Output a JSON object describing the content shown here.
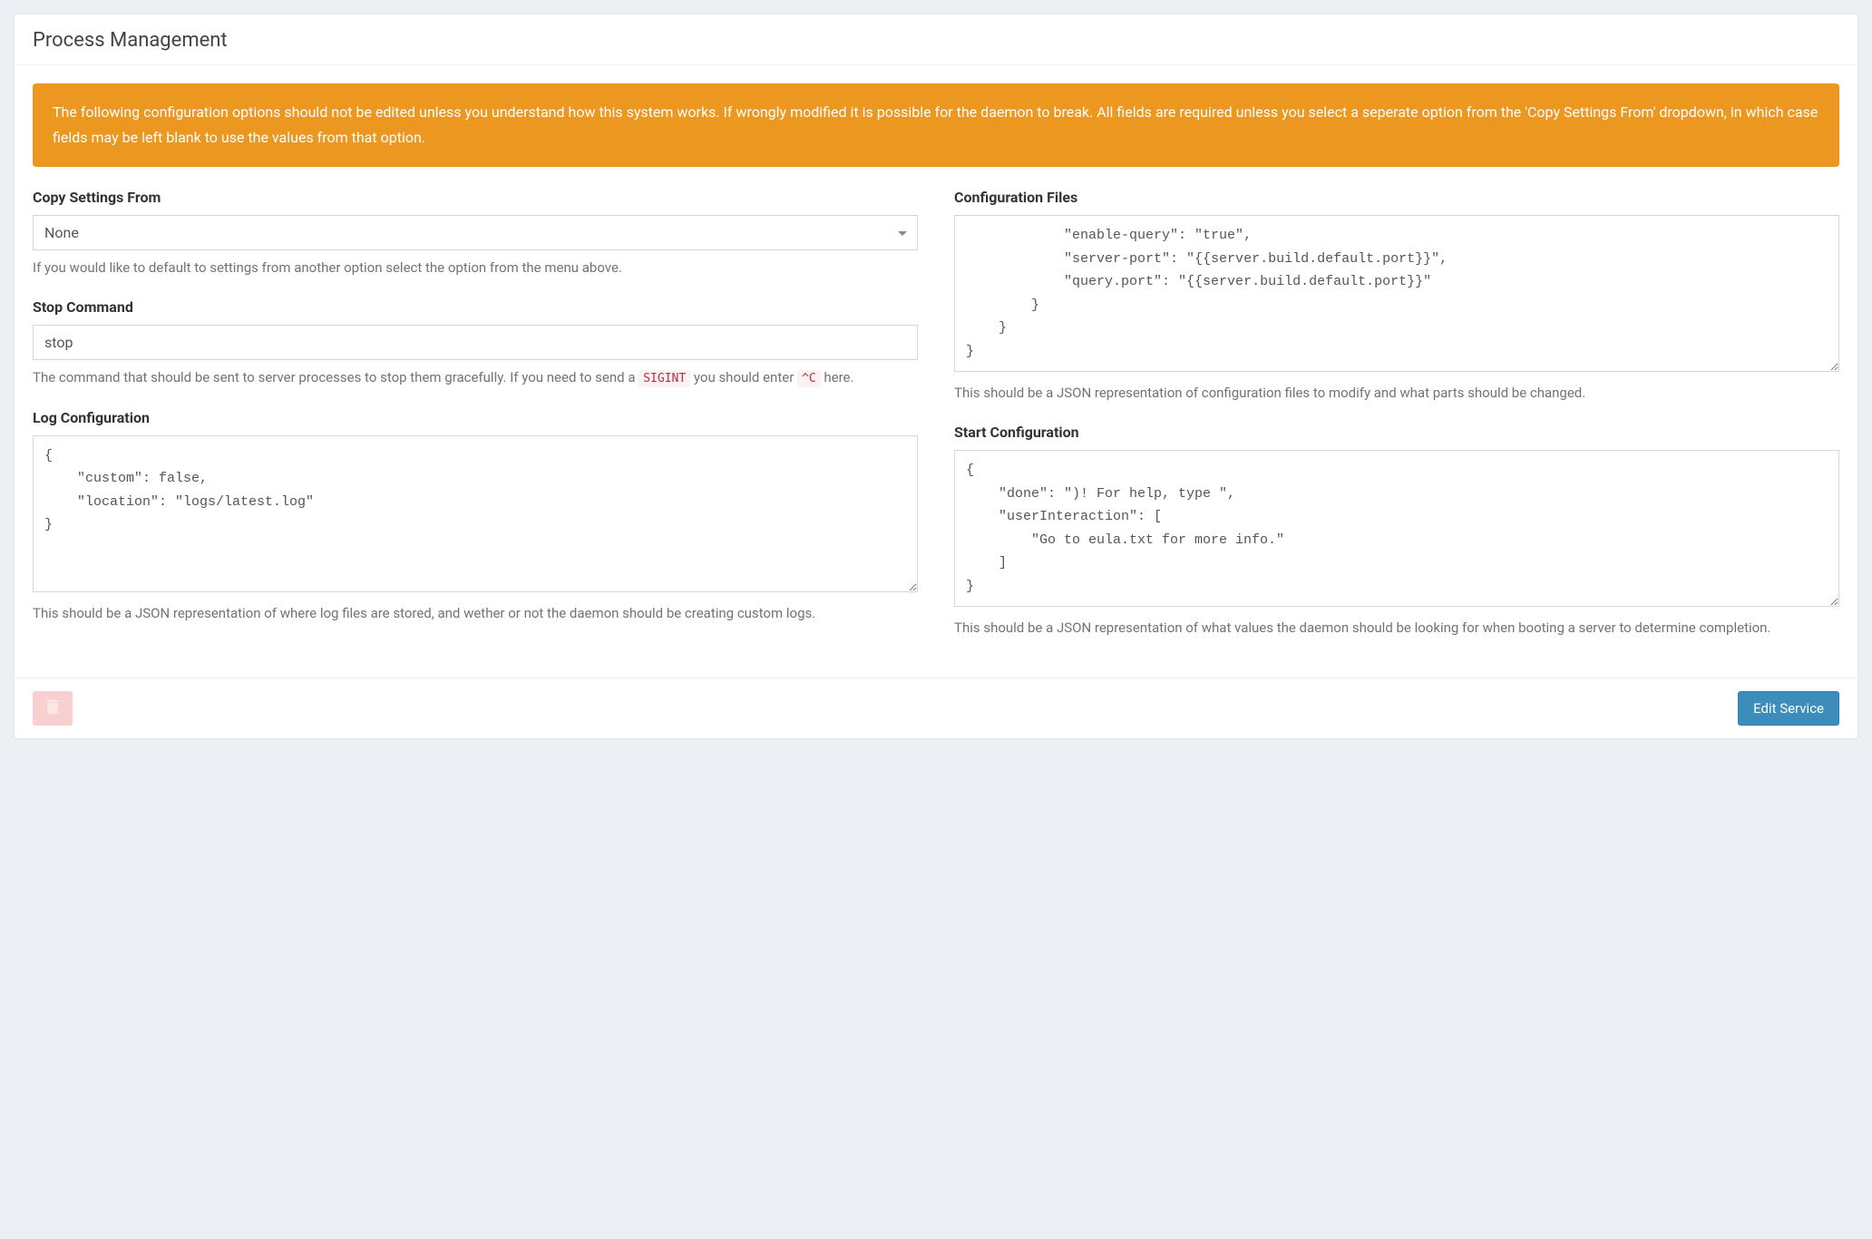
{
  "panel": {
    "title": "Process Management"
  },
  "alert": {
    "text": "The following configuration options should not be edited unless you understand how this system works. If wrongly modified it is possible for the daemon to break. All fields are required unless you select a seperate option from the 'Copy Settings From' dropdown, in which case fields may be left blank to use the values from that option."
  },
  "left": {
    "copy_from": {
      "label": "Copy Settings From",
      "value": "None",
      "help": "If you would like to default to settings from another option select the option from the menu above."
    },
    "stop_command": {
      "label": "Stop Command",
      "value": "stop",
      "help_before_code1": "The command that should be sent to server processes to stop them gracefully. If you need to send a ",
      "code1": "SIGINT",
      "help_mid": " you should enter ",
      "code2": "^C",
      "help_after": " here."
    },
    "log_config": {
      "label": "Log Configuration",
      "value": "{\n    \"custom\": false,\n    \"location\": \"logs/latest.log\"\n}",
      "help": "This should be a JSON representation of where log files are stored, and wether or not the daemon should be creating custom logs."
    }
  },
  "right": {
    "config_files": {
      "label": "Configuration Files",
      "value": "            \"enable-query\": \"true\",\n            \"server-port\": \"{{server.build.default.port}}\",\n            \"query.port\": \"{{server.build.default.port}}\"\n        }\n    }\n}",
      "help": "This should be a JSON representation of configuration files to modify and what parts should be changed."
    },
    "start_config": {
      "label": "Start Configuration",
      "value": "{\n    \"done\": \")! For help, type \",\n    \"userInteraction\": [\n        \"Go to eula.txt for more info.\"\n    ]\n}",
      "help": "This should be a JSON representation of what values the daemon should be looking for when booting a server to determine completion."
    }
  },
  "footer": {
    "delete_label": "Delete",
    "edit_label": "Edit Service"
  }
}
